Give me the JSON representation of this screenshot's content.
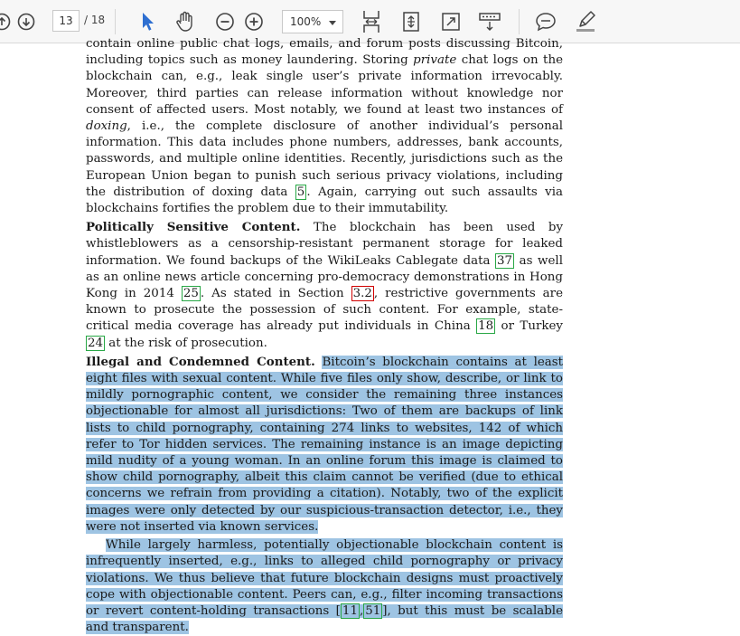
{
  "toolbar": {
    "page_current": "13",
    "page_total": "/ 18",
    "zoom": "100%"
  },
  "document": {
    "p1": "contain online public chat logs, emails, and forum posts discussing Bitcoin, including topics such as money laundering. Storing private chat logs on the blockchain can, e.g., leak single user’s private information irrevocably. Moreover, third parties can release information without knowledge nor consent of affected users. Most notably, we found at least two instances of doxing, i.e., the complete disclosure of another individual’s personal information. This data includes phone numbers, addresses, bank accounts, passwords, and multiple online identities. Recently, jurisdictions such as the European Union began to punish such serious privacy violations, including the distribution of doxing data [5]. Again, carrying out such assaults via blockchains fortifies the problem due to their immutability.",
    "p2_heading": "Politically Sensitive Content.",
    "p2_text": "The blockchain has been used by whistleblowers as a censorship-resistant permanent storage for leaked information. We found backups of the WikiLeaks Cablegate data [37] as well as an online news article concerning pro-democracy demonstrations in Hong Kong in 2014 [25]. As stated in Section 3.2, restrictive governments are known to prosecute the possession of such content. For example, state-critical media coverage has already put individuals in China [18] or Turkey [24] at the risk of prosecution.",
    "p3_heading": "Illegal and Condemned Content.",
    "p3_text": "Bitcoin’s blockchain contains at least eight files with sexual content. While five files only show, describe, or link to mildly pornographic content, we consider the remaining three instances objectionable for almost all jurisdictions: Two of them are backups of link lists to child pornography, containing 274 links to websites, 142 of which refer to Tor hidden services. The remaining instance is an image depicting mild nudity of a young woman. In an online forum this image is claimed to show child pornography, albeit this claim cannot be verified (due to ethical concerns we refrain from providing a citation). Notably, two of the explicit images were only detected by our suspicious-transaction detector, i.e., they were not inserted via known services.",
    "p4": "While largely harmless, potentially objectionable blockchain content is infrequently inserted, e.g., links to alleged child pornography or privacy violations. We thus believe that future blockchain designs must proactively cope with objectionable content. Peers can, e.g., filter incoming transactions or revert content-holding transactions [11,51], but this must be scalable and transparent."
  }
}
